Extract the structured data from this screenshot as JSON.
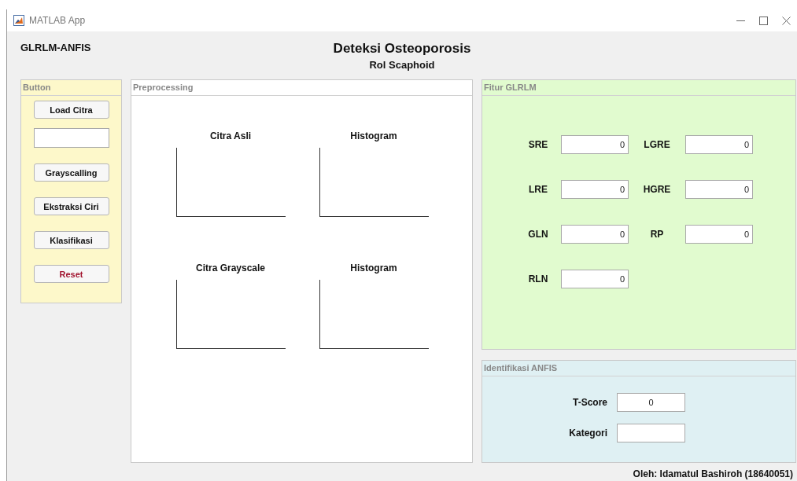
{
  "window": {
    "title": "MATLAB App"
  },
  "header": {
    "app_name": "GLRLM-ANFIS",
    "title": "Deteksi Osteoporosis",
    "subtitle": "Rol Scaphoid"
  },
  "button_panel": {
    "title": "Button",
    "items": [
      {
        "kind": "button",
        "label": "Load Citra"
      },
      {
        "kind": "field"
      },
      {
        "kind": "button",
        "label": "Grayscalling"
      },
      {
        "kind": "button",
        "label": "Ekstraksi Ciri"
      },
      {
        "kind": "button",
        "label": "Klasifikasi"
      },
      {
        "kind": "danger-button",
        "label": "Reset"
      }
    ]
  },
  "preprocessing": {
    "title": "Preprocessing",
    "axes": [
      {
        "title": "Citra Asli"
      },
      {
        "title": "Histogram"
      },
      {
        "title": "Citra Grayscale"
      },
      {
        "title": "Histogram"
      }
    ]
  },
  "features": {
    "title": "Fitur GLRLM",
    "fields": [
      {
        "label": "SRE",
        "value": "0"
      },
      {
        "label": "LGRE",
        "value": "0"
      },
      {
        "label": "LRE",
        "value": "0"
      },
      {
        "label": "HGRE",
        "value": "0"
      },
      {
        "label": "GLN",
        "value": "0"
      },
      {
        "label": "RP",
        "value": "0"
      },
      {
        "label": "RLN",
        "value": "0"
      }
    ]
  },
  "anfis": {
    "title": "Identifikasi ANFIS",
    "fields": [
      {
        "label": "T-Score",
        "value": "0"
      },
      {
        "label": "Kategori"
      }
    ]
  },
  "footer": "Oleh: Idamatul Bashiroh (18640051)"
}
